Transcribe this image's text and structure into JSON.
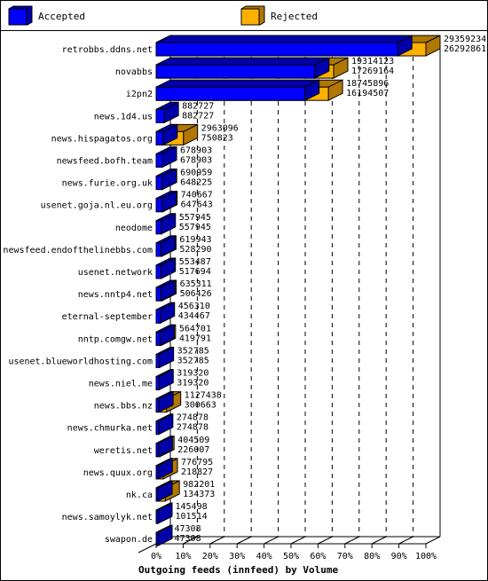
{
  "chart_data": {
    "type": "bar",
    "orientation": "horizontal",
    "style": "3d-overlapping",
    "title": "Outgoing feeds (innfeed) by Volume",
    "xlabel": "",
    "ylabel": "",
    "xlim": [
      0,
      100
    ],
    "x_unit": "percent of maximum",
    "grid": true,
    "legend_placement": "top",
    "x_ticks": [
      "0%",
      "10%",
      "20%",
      "30%",
      "40%",
      "50%",
      "60%",
      "70%",
      "80%",
      "90%",
      "100%"
    ],
    "max_value": 29359234,
    "categories": [
      "retrobbs.ddns.net",
      "novabbs",
      "i2pn2",
      "news.1d4.us",
      "news.hispagatos.org",
      "newsfeed.bofh.team",
      "news.furie.org.uk",
      "usenet.goja.nl.eu.org",
      "neodome",
      "newsfeed.endofthelinebbs.com",
      "usenet.network",
      "news.nntp4.net",
      "eternal-september",
      "nntp.comgw.net",
      "usenet.blueworldhosting.com",
      "news.niel.me",
      "news.bbs.nz",
      "news.chmurka.net",
      "weretis.net",
      "news.quux.org",
      "nk.ca",
      "news.samoylyk.net",
      "swapon.de"
    ],
    "series": [
      {
        "name": "Rejected",
        "color": "#ffb000",
        "values": [
          29359234,
          19314123,
          18745896,
          882727,
          2963096,
          678903,
          690959,
          740667,
          557945,
          619943,
          553487,
          635311,
          456310,
          564701,
          352785,
          319320,
          1127438,
          274878,
          404509,
          776795,
          982201,
          145498,
          47308
        ]
      },
      {
        "name": "Accepted",
        "color": "#0000ff",
        "values": [
          26292861,
          17269164,
          16194507,
          882727,
          750823,
          678903,
          648225,
          647643,
          557945,
          528290,
          517694,
          506426,
          434467,
          419791,
          352785,
          319320,
          300663,
          274878,
          226007,
          218827,
          134373,
          101514,
          47308
        ]
      }
    ]
  },
  "legend": [
    {
      "label": "Accepted",
      "color": "#0000ff"
    },
    {
      "label": "Rejected",
      "color": "#ffb000"
    }
  ]
}
